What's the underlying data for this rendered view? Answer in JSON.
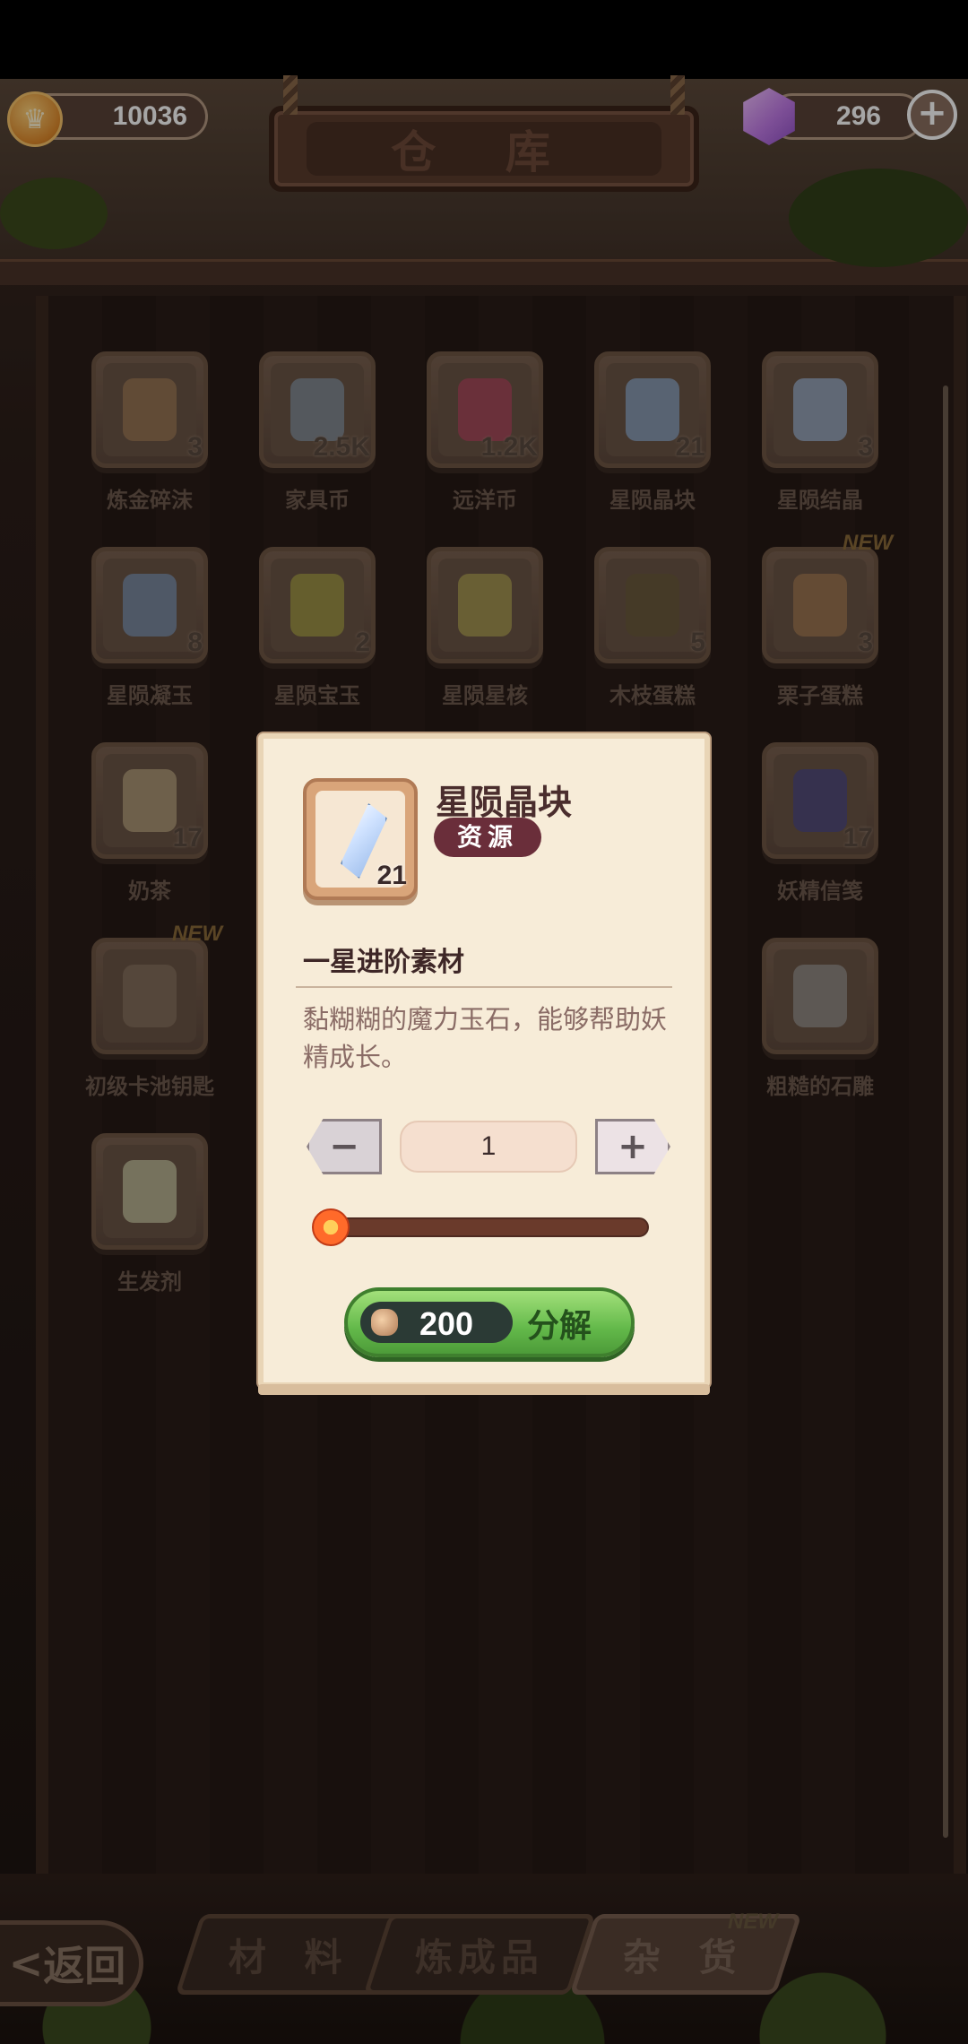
{
  "top_bar": {
    "coins": "10036",
    "gems": "296",
    "title": "仓 库",
    "plus_label": "+"
  },
  "items": [
    {
      "name": "炼金碎沫",
      "count": "3",
      "icon": "alchemy-dust-icon",
      "new": false
    },
    {
      "name": "家具币",
      "count": "2.5K",
      "icon": "furniture-coin-icon",
      "new": false
    },
    {
      "name": "远洋币",
      "count": "1.2K",
      "icon": "ocean-coin-icon",
      "new": false
    },
    {
      "name": "星陨晶块",
      "count": "21",
      "icon": "crystal-block-icon",
      "new": false
    },
    {
      "name": "星陨结晶",
      "count": "3",
      "icon": "crystal-icon",
      "new": false
    },
    {
      "name": "星陨凝玉",
      "count": "8",
      "icon": "star-jade-icon",
      "new": false
    },
    {
      "name": "星陨宝玉",
      "count": "2",
      "icon": "yellow-gem-icon",
      "new": false
    },
    {
      "name": "星陨星核",
      "count": "",
      "icon": "star-core-icon",
      "new": false
    },
    {
      "name": "木枝蛋糕",
      "count": "5",
      "icon": "log-cake-icon",
      "new": false
    },
    {
      "name": "栗子蛋糕",
      "count": "3",
      "icon": "chestnut-cake-icon",
      "new": true
    },
    {
      "name": "奶茶",
      "count": "17",
      "icon": "milk-tea-icon",
      "new": false
    },
    {
      "name": "妖精信笺",
      "count": "17",
      "icon": "fairy-letter-icon",
      "new": false
    },
    {
      "name": "初级卡池钥匙",
      "count": "",
      "icon": "key-icon",
      "new": true
    },
    {
      "name": "粗糙的石雕",
      "count": "",
      "icon": "stone-statue-icon",
      "new": false
    },
    {
      "name": "生发剂",
      "count": "",
      "icon": "hair-tonic-icon",
      "new": false
    }
  ],
  "new_label": "NEW",
  "modal": {
    "item_name": "星陨晶块",
    "item_count": "21",
    "type_badge": "资源",
    "subtitle": "一星进阶素材",
    "description": "黏糊糊的魔力玉石，能够帮助妖精成长。",
    "minus_label": "−",
    "plus_label": "+",
    "quantity": "1",
    "slider_value": 0,
    "cost": "200",
    "action_label": "分解"
  },
  "bottom": {
    "back_label": "返回",
    "back_chevron": "<",
    "tabs": [
      "材 料",
      "炼成品",
      "杂 货"
    ],
    "active_tab": 2,
    "tab_new": "NEW"
  }
}
